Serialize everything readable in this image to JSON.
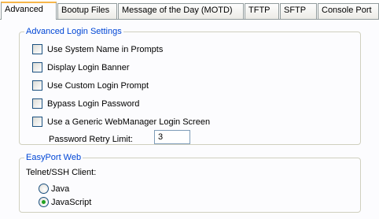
{
  "tabs": [
    {
      "label": "Advanced",
      "active": true
    },
    {
      "label": "Bootup Files",
      "active": false
    },
    {
      "label": "Message of the Day (MOTD)",
      "active": false
    },
    {
      "label": "TFTP",
      "active": false
    },
    {
      "label": "SFTP",
      "active": false
    },
    {
      "label": "Console Port",
      "active": false
    }
  ],
  "advanced_login": {
    "legend": "Advanced Login Settings",
    "options": [
      {
        "label": "Use System Name in Prompts",
        "checked": false
      },
      {
        "label": "Display Login Banner",
        "checked": false
      },
      {
        "label": "Use Custom Login Prompt",
        "checked": false
      },
      {
        "label": "Bypass Login Password",
        "checked": false
      },
      {
        "label": "Use a Generic WebManager Login Screen",
        "checked": false
      }
    ],
    "retry_label": "Password Retry Limit:",
    "retry_value": "3"
  },
  "easyport": {
    "legend": "EasyPort Web",
    "client_label": "Telnet/SSH Client:",
    "options": [
      {
        "label": "Java",
        "selected": false
      },
      {
        "label": "JavaScript",
        "selected": true
      }
    ]
  },
  "colors": {
    "legend_text": "#0046d5",
    "active_tab_accent": "#f7b64a",
    "radio_dot": "#21a121"
  }
}
